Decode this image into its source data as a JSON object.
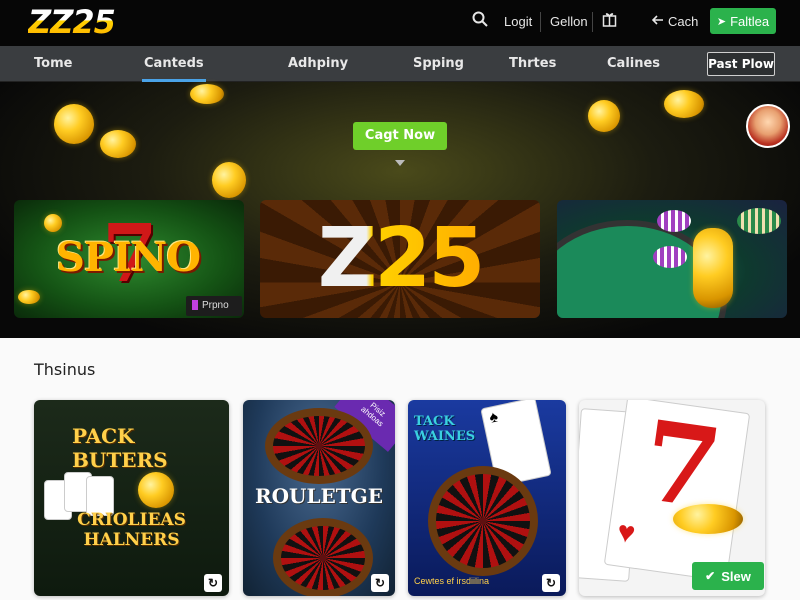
{
  "header": {
    "logo_text": "ZZ25",
    "login_label": "Logit",
    "gallery_label": "Gellon",
    "cash_label": "Cach",
    "follow_label": "Faltlea"
  },
  "nav": {
    "items": [
      {
        "label": "Tome",
        "active": false
      },
      {
        "label": "Canteds",
        "active": true
      },
      {
        "label": "Adhpiny",
        "active": false
      },
      {
        "label": "Spping",
        "active": false
      },
      {
        "label": "Thrtes",
        "active": false
      },
      {
        "label": "Calines",
        "active": false
      }
    ],
    "button_label": "Past Plow"
  },
  "hero": {
    "cta_label": "Cagt Now",
    "banners": {
      "left_title": "SPINO",
      "left_seven": "7",
      "left_tag": "Prpno",
      "center_title": "Z25"
    }
  },
  "section": {
    "title": "Thsinus",
    "cards": [
      {
        "title_top": "PACK BUTERS",
        "title_bottom": "CRIOLIEAS HALNERS"
      },
      {
        "title": "ROULETGE",
        "corner_ribbon": "Pisiz ahdoas"
      },
      {
        "title_top": "TACK WAINES",
        "caption": "Cewtes ef irsdiilina"
      },
      {
        "big_seven": "7"
      }
    ],
    "view_label": "Slew"
  },
  "colors": {
    "accent_green": "#2bb24c",
    "cta_green": "#6fcf2a",
    "nav_bg": "#3a3d40",
    "active_tab": "#4aa3e8",
    "gold": "#ffc21a"
  }
}
